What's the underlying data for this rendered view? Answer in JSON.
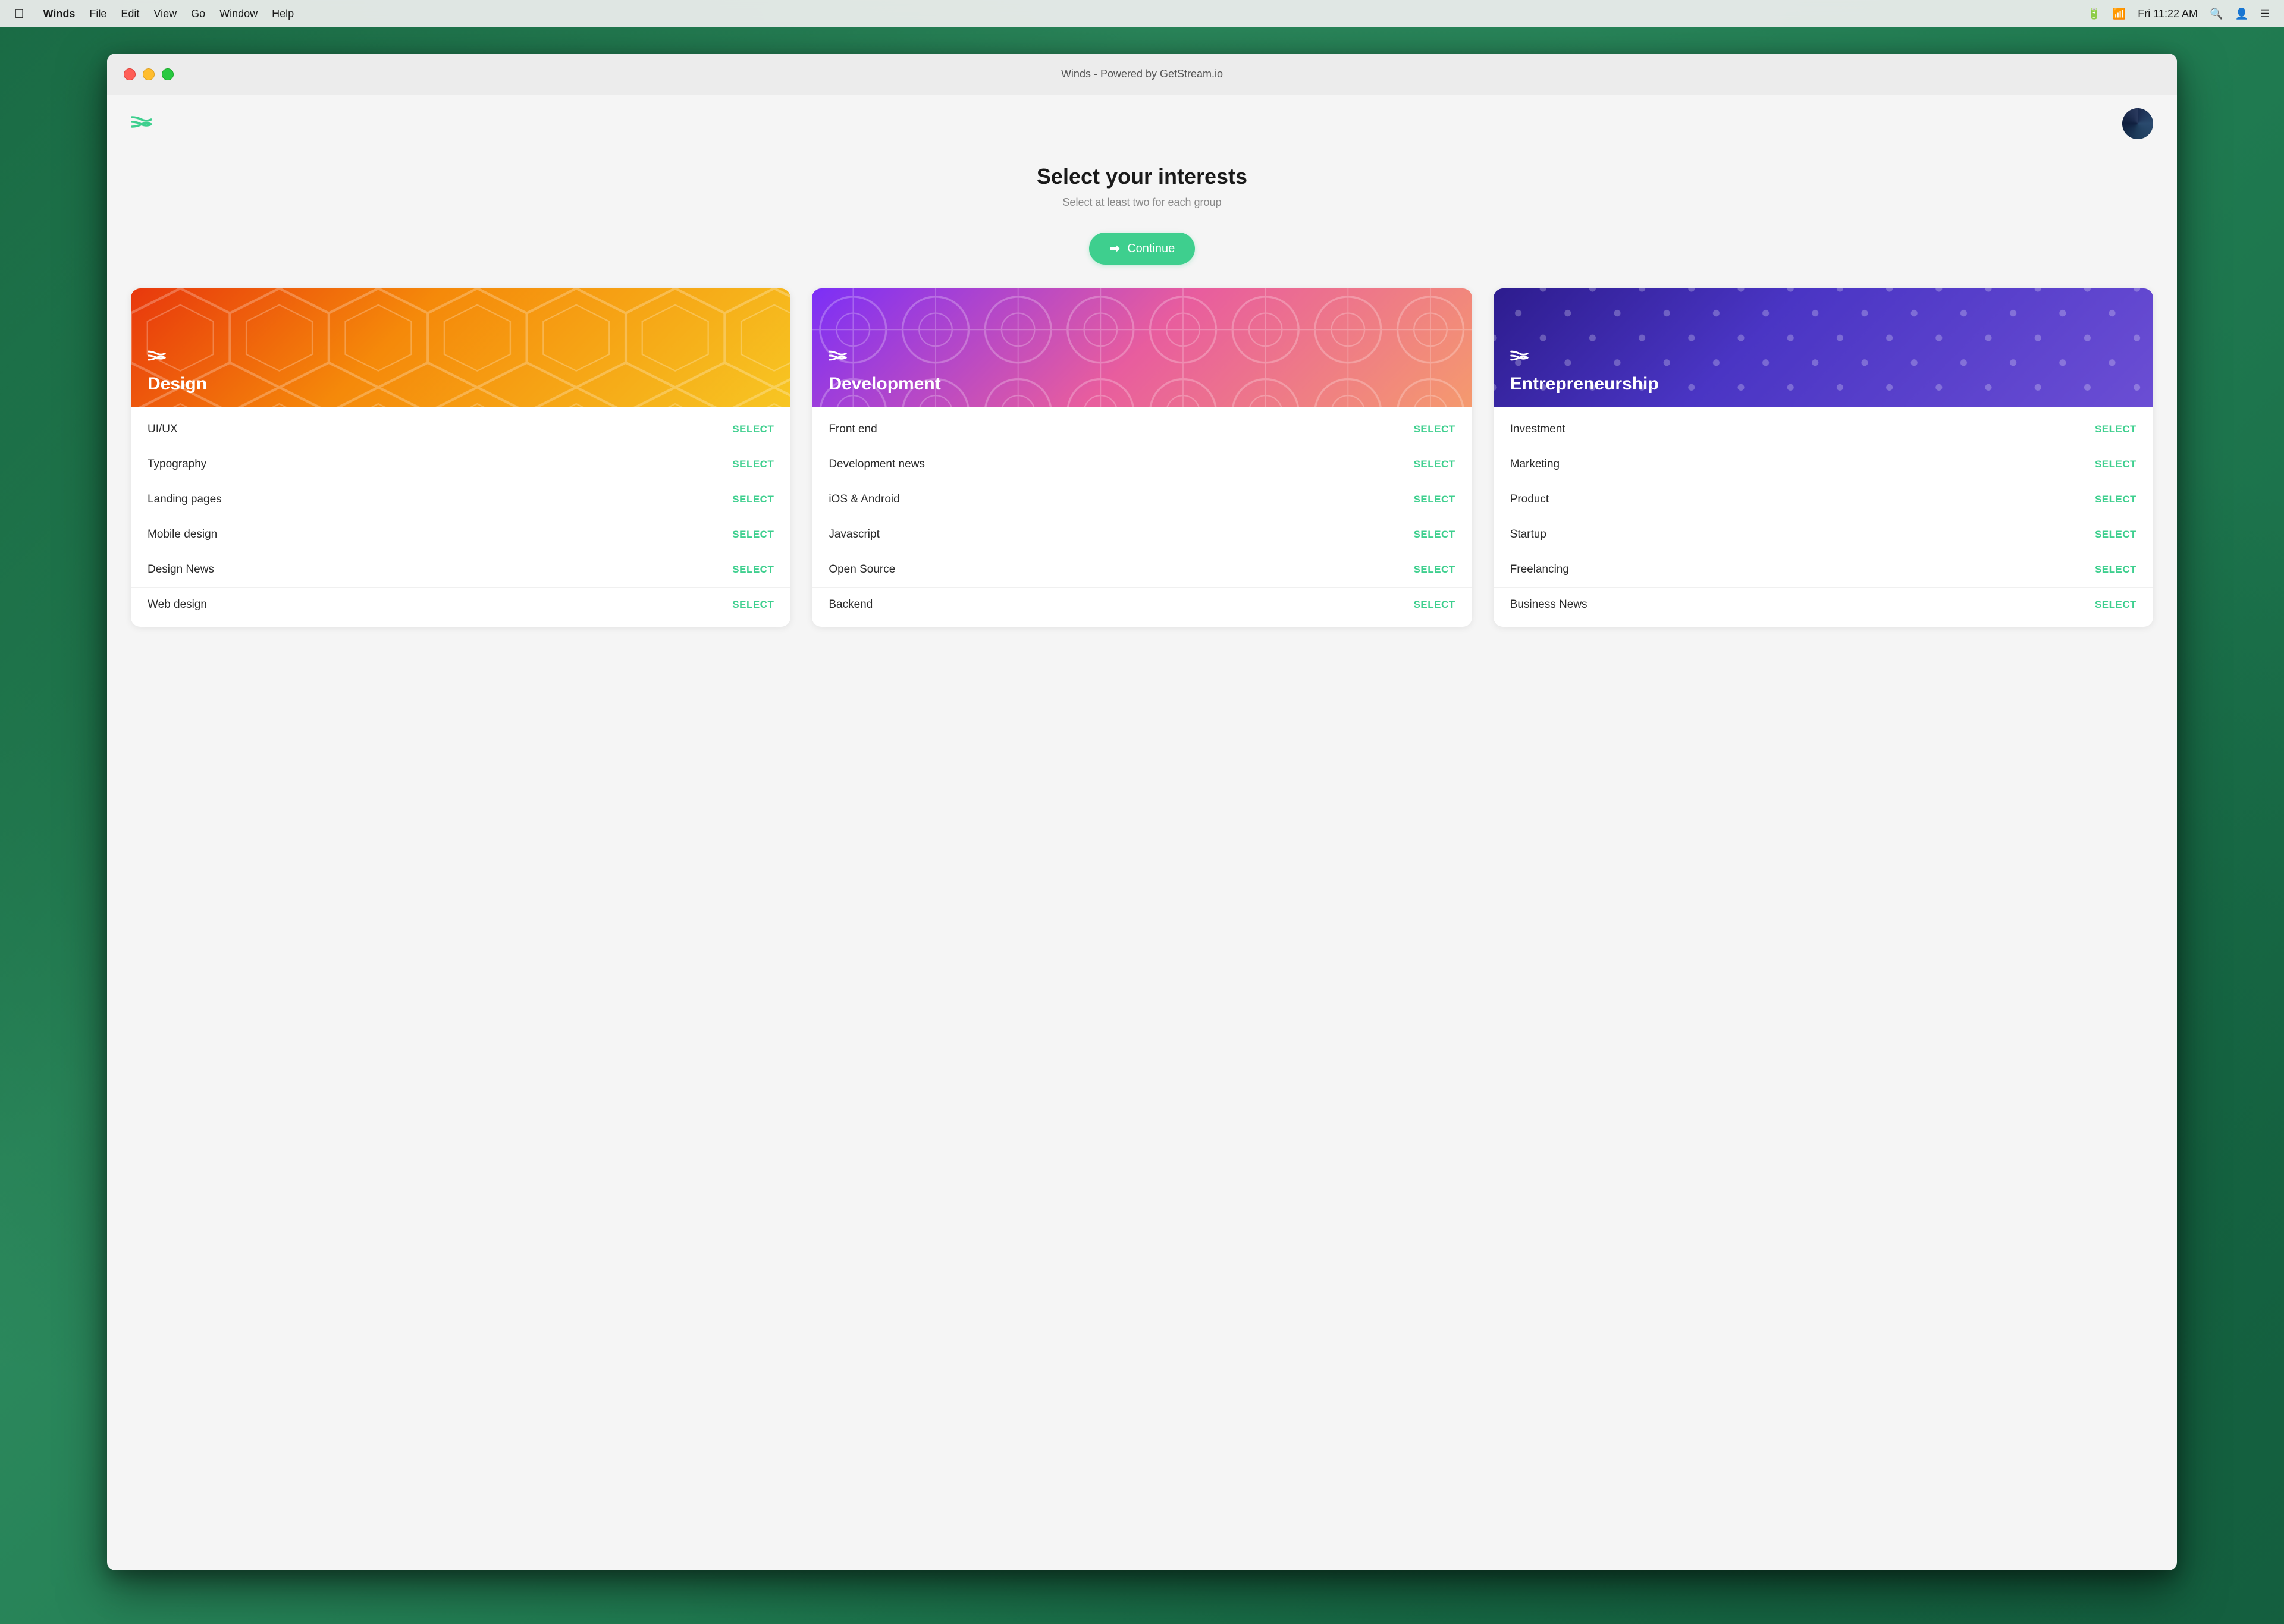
{
  "menubar": {
    "apple": "🍎",
    "items": [
      "Winds",
      "File",
      "Edit",
      "View",
      "Go",
      "Window",
      "Help"
    ],
    "winds_bold": true,
    "right": {
      "time": "Fri 11:22 AM",
      "battery": "100%"
    }
  },
  "window": {
    "title": "Winds - Powered by GetStream.io",
    "titlebar_controls": [
      "close",
      "minimize",
      "maximize"
    ]
  },
  "page": {
    "title": "Select your interests",
    "subtitle": "Select at least two for each group",
    "continue_button": "Continue"
  },
  "categories": [
    {
      "id": "design",
      "name": "Design",
      "gradient": "design",
      "items": [
        {
          "label": "UI/UX",
          "action": "SELECT"
        },
        {
          "label": "Typography",
          "action": "SELECT"
        },
        {
          "label": "Landing pages",
          "action": "SELECT"
        },
        {
          "label": "Mobile design",
          "action": "SELECT"
        },
        {
          "label": "Design News",
          "action": "SELECT"
        },
        {
          "label": "Web design",
          "action": "SELECT"
        }
      ]
    },
    {
      "id": "development",
      "name": "Development",
      "gradient": "development",
      "items": [
        {
          "label": "Front end",
          "action": "SELECT"
        },
        {
          "label": "Development news",
          "action": "SELECT"
        },
        {
          "label": "iOS & Android",
          "action": "SELECT"
        },
        {
          "label": "Javascript",
          "action": "SELECT"
        },
        {
          "label": "Open Source",
          "action": "SELECT"
        },
        {
          "label": "Backend",
          "action": "SELECT"
        }
      ]
    },
    {
      "id": "entrepreneurship",
      "name": "Entrepreneurship",
      "gradient": "entrepreneurship",
      "items": [
        {
          "label": "Investment",
          "action": "SELECT"
        },
        {
          "label": "Marketing",
          "action": "SELECT"
        },
        {
          "label": "Product",
          "action": "SELECT"
        },
        {
          "label": "Startup",
          "action": "SELECT"
        },
        {
          "label": "Freelancing",
          "action": "SELECT"
        },
        {
          "label": "Business News",
          "action": "SELECT"
        }
      ]
    }
  ],
  "colors": {
    "accent": "#3ecf8e",
    "design_gradient_start": "#e8380d",
    "design_gradient_end": "#f7c623",
    "development_gradient_start": "#7b2ff7",
    "development_gradient_end": "#f59a6e",
    "entrepreneurship_gradient_start": "#2d1c8e",
    "entrepreneurship_gradient_end": "#6b4ed4"
  }
}
